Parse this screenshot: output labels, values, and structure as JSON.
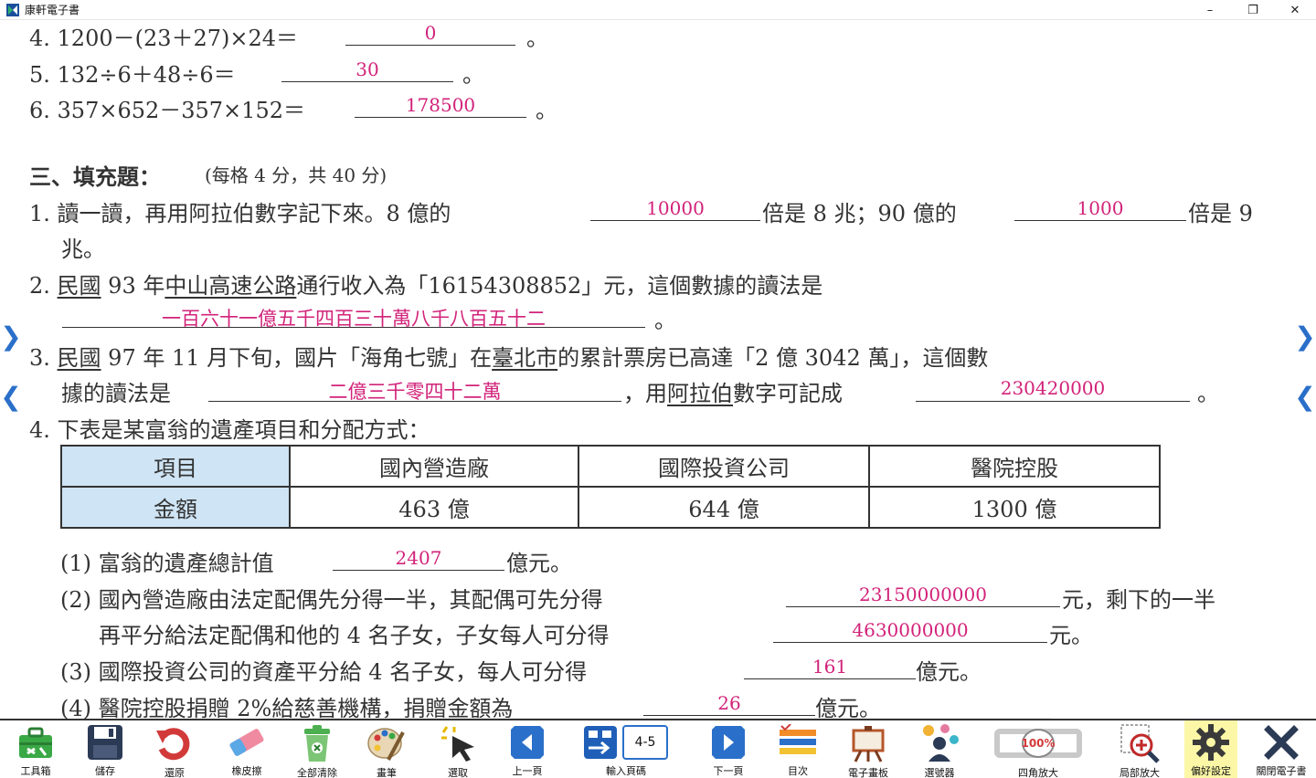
{
  "window": {
    "title": "康軒電子書",
    "minimize_glyph": "–",
    "maximize_glyph": "❐",
    "close_glyph": "✕"
  },
  "content": {
    "q4": {
      "text": "4. 1200－(23＋27)×24＝",
      "answer": "0",
      "end": "。"
    },
    "q5": {
      "text": "5. 132÷6＋48÷6＝",
      "answer": "30",
      "end": "。"
    },
    "q6": {
      "text": "6. 357×652－357×152＝",
      "answer": "178500",
      "end": "。"
    },
    "section_title": "三、填充題：",
    "section_note": "(每格 4 分，共 40 分)",
    "f1": {
      "part1": "1. 讀一讀，再用阿拉伯數字記下來。8 億的",
      "answer1": "10000",
      "part2": "倍是 8 兆；90 億的",
      "answer2": "1000",
      "part3": "倍是 9",
      "line2": "兆。"
    },
    "f2": {
      "num": "2.",
      "minguo": "民國",
      "part1": " 93 年",
      "road": "中山高速公路",
      "part2": "通行收入為「16154308852」元，這個數據的讀法是",
      "answer": "一百六十一億五千四百三十萬八千八百五十二",
      "end": "。"
    },
    "f3": {
      "num": "3.",
      "minguo": "民國",
      "part1": " 97 年 11 月下旬，國片「海角七號」在",
      "city": "臺北市",
      "part2": "的累計票房已高達「2 億 3042 萬」，這個數",
      "line2a": "據的讀法是",
      "answer1": "二億三千零四十二萬",
      "line2b": "，用",
      "arabic": "阿拉伯",
      "line2c": "數字可記成",
      "answer2": "230420000",
      "end": "。"
    },
    "f4": {
      "text": "4. 下表是某富翁的遺產項目和分配方式："
    },
    "table": {
      "header": [
        "項目",
        "國內營造廠",
        "國際投資公司",
        "醫院控股"
      ],
      "row": [
        "金額",
        "463 億",
        "644 億",
        "1300 億"
      ]
    },
    "s1": {
      "part1": "(1) 富翁的遺產總計值",
      "answer": "2407",
      "part2": "億元。"
    },
    "s2": {
      "part1": "(2) 國內營造廠由法定配偶先分得一半，其配偶可先分得",
      "answer1": "23150000000",
      "part2": "元，剩下的一半",
      "line2a": "再平分給法定配偶和他的 4 名子女，子女每人可分得",
      "answer2": "4630000000",
      "line2b": "元。"
    },
    "s3": {
      "part1": "(3) 國際投資公司的資產平分給 4 名子女，每人可分得",
      "answer": "161",
      "part2": "億元。"
    },
    "s4": {
      "part1": "(4) 醫院控股捐贈 2%給慈善機構，捐贈金額為",
      "answer": "26",
      "part2": "億元。"
    }
  },
  "side_nav": {
    "next": "❯",
    "prev": "❮"
  },
  "toolbar": {
    "toolbox": "工具箱",
    "save": "儲存",
    "restore": "還原",
    "eraser": "橡皮擦",
    "clear_all": "全部清除",
    "pen": "畫筆",
    "select": "選取",
    "prev_page": "上一頁",
    "goto_page": "輸入頁碼",
    "page_value": "4-5",
    "next_page": "下一頁",
    "toc": "目次",
    "whiteboard": "電子畫板",
    "picker": "選號器",
    "zoom_four": "四角放大",
    "zoom_percent": "100%",
    "zoom_local": "局部放大",
    "settings": "偏好設定",
    "close_book": "關閉電子書"
  },
  "colors": {
    "answer": "#d2237a",
    "table_header": "#cfe4f4",
    "accent_blue": "#2a6fc9",
    "settings_highlight": "#fbf7a6"
  }
}
